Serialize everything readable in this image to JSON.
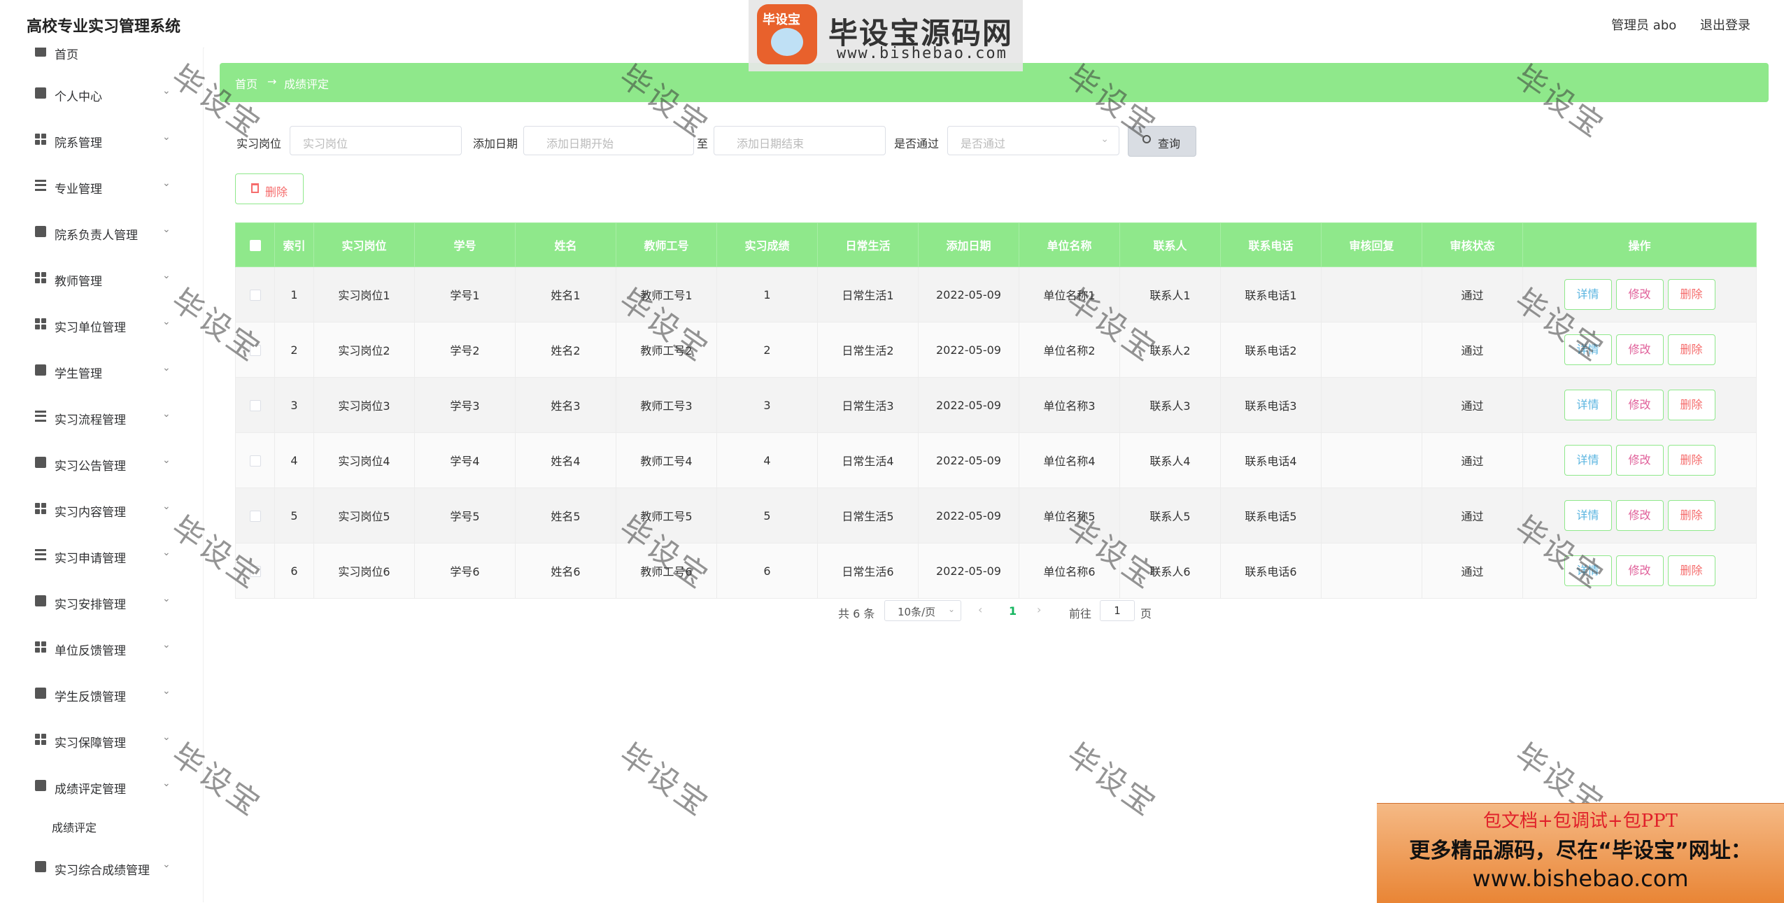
{
  "app": {
    "title": "高校专业实习管理系统",
    "admin_label": "管理员 abo",
    "logout_label": "退出登录"
  },
  "sidebar": {
    "items": [
      {
        "label": "首页",
        "icon": "home-icon"
      },
      {
        "label": "个人中心",
        "icon": "user-icon"
      },
      {
        "label": "院系管理",
        "icon": "grid-icon"
      },
      {
        "label": "专业管理",
        "icon": "sliders-icon"
      },
      {
        "label": "院系负责人管理",
        "icon": "user-card-icon"
      },
      {
        "label": "教师管理",
        "icon": "grid-icon"
      },
      {
        "label": "实习单位管理",
        "icon": "grid-icon"
      },
      {
        "label": "学生管理",
        "icon": "user-icon"
      },
      {
        "label": "实习流程管理",
        "icon": "list-icon"
      },
      {
        "label": "实习公告管理",
        "icon": "message-icon"
      },
      {
        "label": "实习内容管理",
        "icon": "grid-icon"
      },
      {
        "label": "实习申请管理",
        "icon": "list-icon"
      },
      {
        "label": "实习安排管理",
        "icon": "send-icon"
      },
      {
        "label": "单位反馈管理",
        "icon": "grid-icon"
      },
      {
        "label": "学生反馈管理",
        "icon": "chart-icon"
      },
      {
        "label": "实习保障管理",
        "icon": "grid-icon"
      },
      {
        "label": "成绩评定管理",
        "icon": "document-icon"
      },
      {
        "label": "实习综合成绩管理",
        "icon": "pin-icon"
      }
    ],
    "sub_item": "成绩评定"
  },
  "breadcrumb": {
    "home": "首页",
    "arrow": "→",
    "current": "成绩评定"
  },
  "search": {
    "position_label": "实习岗位",
    "position_placeholder": "实习岗位",
    "date_label": "添加日期",
    "date_start_placeholder": "添加日期开始",
    "to_label": "至",
    "date_end_placeholder": "添加日期结束",
    "pass_label": "是否通过",
    "pass_placeholder": "是否通过",
    "query_label": "查询"
  },
  "toolbar": {
    "delete_label": "删除"
  },
  "table": {
    "headers": [
      "索引",
      "实习岗位",
      "学号",
      "姓名",
      "教师工号",
      "实习成绩",
      "日常生活",
      "添加日期",
      "单位名称",
      "联系人",
      "联系电话",
      "审核回复",
      "审核状态",
      "操作"
    ],
    "rows": [
      [
        "1",
        "实习岗位1",
        "学号1",
        "姓名1",
        "教师工号1",
        "1",
        "日常生活1",
        "2022-05-09",
        "单位名称1",
        "联系人1",
        "联系电话1",
        "",
        "通过"
      ],
      [
        "2",
        "实习岗位2",
        "学号2",
        "姓名2",
        "教师工号2",
        "2",
        "日常生活2",
        "2022-05-09",
        "单位名称2",
        "联系人2",
        "联系电话2",
        "",
        "通过"
      ],
      [
        "3",
        "实习岗位3",
        "学号3",
        "姓名3",
        "教师工号3",
        "3",
        "日常生活3",
        "2022-05-09",
        "单位名称3",
        "联系人3",
        "联系电话3",
        "",
        "通过"
      ],
      [
        "4",
        "实习岗位4",
        "学号4",
        "姓名4",
        "教师工号4",
        "4",
        "日常生活4",
        "2022-05-09",
        "单位名称4",
        "联系人4",
        "联系电话4",
        "",
        "通过"
      ],
      [
        "5",
        "实习岗位5",
        "学号5",
        "姓名5",
        "教师工号5",
        "5",
        "日常生活5",
        "2022-05-09",
        "单位名称5",
        "联系人5",
        "联系电话5",
        "",
        "通过"
      ],
      [
        "6",
        "实习岗位6",
        "学号6",
        "姓名6",
        "教师工号6",
        "6",
        "日常生活6",
        "2022-05-09",
        "单位名称6",
        "联系人6",
        "联系电话6",
        "",
        "通过"
      ]
    ],
    "actions": {
      "detail": "详情",
      "edit": "修改",
      "delete": "删除"
    }
  },
  "pagination": {
    "total": "共 6 条",
    "page_size": "10条/页",
    "current_page": "1",
    "goto_label": "前往",
    "goto_value": "1",
    "page_suffix": "页",
    "prev": "‹",
    "next": "›"
  },
  "watermark": {
    "text": "毕设宝"
  },
  "logo": {
    "seal_text": "毕设宝",
    "name": "毕设宝源码网",
    "url": "www.bishebao.com"
  },
  "ad_banner": {
    "line1": "包文档+包调试+包PPT",
    "line2": "更多精品源码，尽在“毕设宝”网址：",
    "line3": "www.bishebao.com"
  },
  "colors": {
    "accent_green": "#8fe88b",
    "danger": "#f56c6c",
    "detail_blue": "#5bb5e0",
    "edit_pink": "#e0609a",
    "page_current": "#13b55e"
  }
}
